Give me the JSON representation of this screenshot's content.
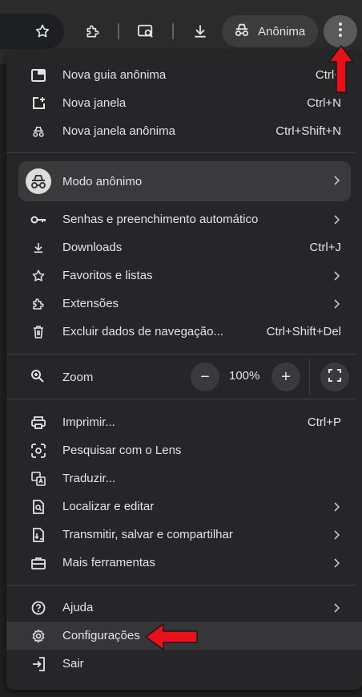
{
  "toolbar": {
    "incognito_label": "Anônima",
    "icons": [
      "star-icon",
      "extensions-icon",
      "lens-icon",
      "download-icon",
      "incognito-icon",
      "kebab-menu-icon"
    ]
  },
  "menu": {
    "new_incognito_tab": {
      "label": "Nova guia anônima",
      "shortcut": "Ctrl+"
    },
    "new_window": {
      "label": "Nova janela",
      "shortcut": "Ctrl+N"
    },
    "new_incognito_window": {
      "label": "Nova janela anônima",
      "shortcut": "Ctrl+Shift+N"
    },
    "profile": {
      "label": "Modo anônimo"
    },
    "passwords": {
      "label": "Senhas e preenchimento automático"
    },
    "downloads": {
      "label": "Downloads",
      "shortcut": "Ctrl+J"
    },
    "bookmarks": {
      "label": "Favoritos e listas"
    },
    "extensions": {
      "label": "Extensões"
    },
    "clear_data": {
      "label": "Excluir dados de navegação...",
      "shortcut": "Ctrl+Shift+Del"
    },
    "zoom": {
      "label": "Zoom",
      "value": "100%",
      "minus": "−",
      "plus": "+"
    },
    "print": {
      "label": "Imprimir...",
      "shortcut": "Ctrl+P"
    },
    "lens": {
      "label": "Pesquisar com o Lens"
    },
    "translate": {
      "label": "Traduzir..."
    },
    "find_edit": {
      "label": "Localizar e editar"
    },
    "cast": {
      "label": "Transmitir, salvar e compartilhar"
    },
    "more_tools": {
      "label": "Mais ferramentas"
    },
    "help": {
      "label": "Ajuda"
    },
    "settings": {
      "label": "Configurações"
    },
    "exit": {
      "label": "Sair"
    }
  },
  "colors": {
    "background": "#1f1f1f",
    "menu": "#262527",
    "highlight": "#363538",
    "arrow": "#e8111b"
  }
}
